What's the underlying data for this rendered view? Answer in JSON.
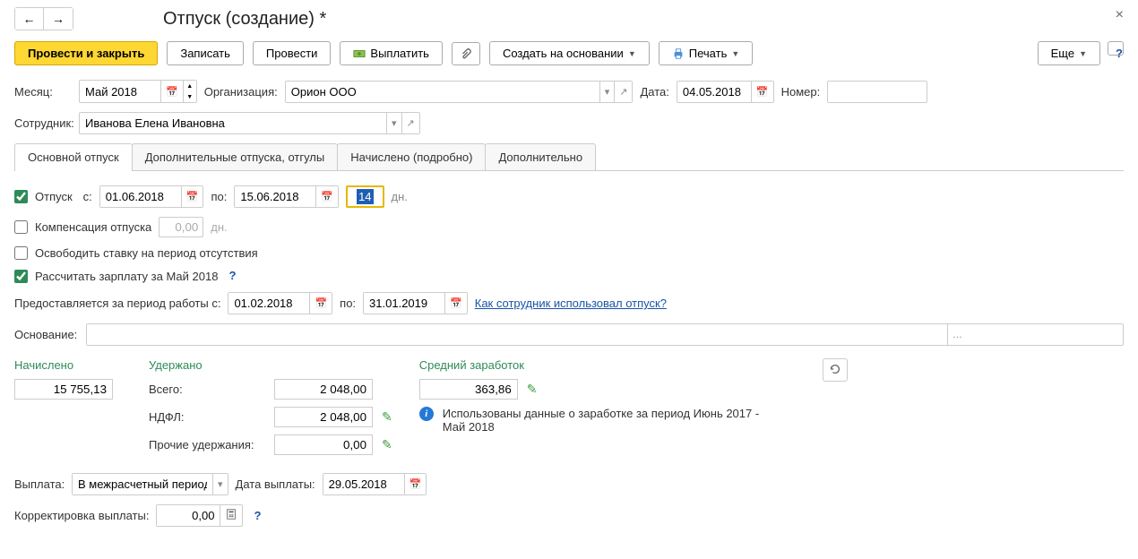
{
  "title": "Отпуск (создание) *",
  "toolbar": {
    "post_close": "Провести и закрыть",
    "save": "Записать",
    "post": "Провести",
    "pay": "Выплатить",
    "create_based": "Создать на основании",
    "print": "Печать",
    "more": "Еще"
  },
  "header": {
    "month_label": "Месяц:",
    "month_value": "Май 2018",
    "org_label": "Организация:",
    "org_value": "Орион ООО",
    "date_label": "Дата:",
    "date_value": "04.05.2018",
    "number_label": "Номер:",
    "number_value": "",
    "employee_label": "Сотрудник:",
    "employee_value": "Иванова Елена Ивановна"
  },
  "tabs": {
    "main": "Основной отпуск",
    "additional": "Дополнительные отпуска, отгулы",
    "accrued": "Начислено (подробно)",
    "extra": "Дополнительно"
  },
  "vacation": {
    "checkbox_label": "Отпуск",
    "from_label": "с:",
    "from_value": "01.06.2018",
    "to_label": "по:",
    "to_value": "15.06.2018",
    "days_value": "14",
    "days_unit": "дн.",
    "compensation_label": "Компенсация отпуска",
    "compensation_value": "0,00",
    "compensation_unit": "дн.",
    "release_label": "Освободить ставку на период отсутствия",
    "calc_label": "Рассчитать зарплату за Май 2018",
    "period_label": "Предоставляется за период работы с:",
    "period_from": "01.02.2018",
    "period_to_label": "по:",
    "period_to": "31.01.2019",
    "usage_link": "Как сотрудник использовал отпуск?",
    "basis_label": "Основание:"
  },
  "summary": {
    "accrued_header": "Начислено",
    "accrued_value": "15 755,13",
    "withheld_header": "Удержано",
    "total_label": "Всего:",
    "total_value": "2 048,00",
    "ndfl_label": "НДФЛ:",
    "ndfl_value": "2 048,00",
    "other_label": "Прочие удержания:",
    "other_value": "0,00",
    "avg_header": "Средний заработок",
    "avg_value": "363,86",
    "info_text": "Использованы данные о заработке за период Июнь 2017 - Май 2018"
  },
  "payout": {
    "label": "Выплата:",
    "value": "В межрасчетный период",
    "date_label": "Дата выплаты:",
    "date_value": "29.05.2018",
    "correction_label": "Корректировка выплаты:",
    "correction_value": "0,00"
  }
}
